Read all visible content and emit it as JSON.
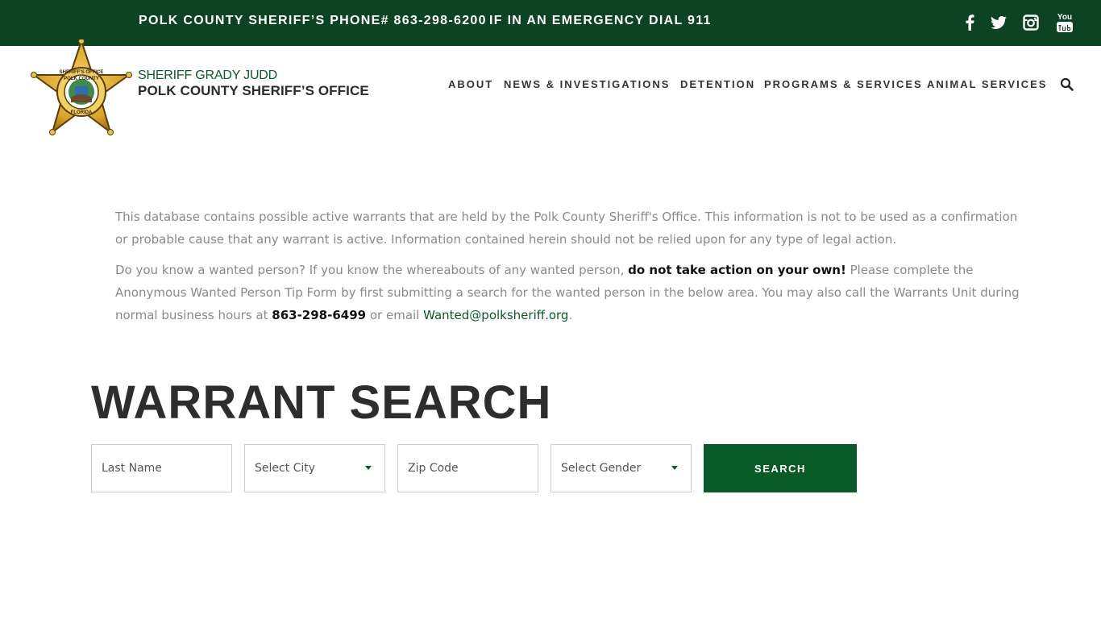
{
  "topbar": {
    "phone": "POLK COUNTY SHERIFF’S PHONE# 863-298-6200",
    "emergency": "IF IN AN EMERGENCY DIAL 911",
    "social_icons": [
      "facebook-icon",
      "twitter-icon",
      "instagram-icon",
      "youtube-icon"
    ],
    "youtube_label": "You"
  },
  "brand": {
    "line1": "SHERIFF GRADY JUDD",
    "line2": "POLK COUNTY SHERIFF’S OFFICE",
    "badge_text_top": "SHERIFF'S OFFICE",
    "badge_text_mid": "POLK COUNTY",
    "badge_text_bottom": "FLORIDA"
  },
  "nav": {
    "items": [
      "ABOUT",
      "NEWS & INVESTIGATIONS",
      "DETENTION",
      "PROGRAMS & SERVICES",
      "ANIMAL SERVICES"
    ]
  },
  "intro": {
    "p1": "This database contains possible active warrants that are held by the Polk County Sheriff's Office. This information is not to be used as a confirmation or probable cause that any warrant is active. Information contained herein should not be relied upon for any type of legal action.",
    "p2_a": "Do you know a wanted person? If you know the whereabouts of any wanted person, ",
    "p2_strong": "do not take action on your own!",
    "p2_b": " Please complete the Anonymous Wanted Person Tip Form by first submitting a search for the wanted person in the below area. You may also call the Warrants Unit during normal business hours at ",
    "p2_phone": "863-298-6499",
    "p2_c": " or email ",
    "p2_email": "Wanted@polksheriff.org",
    "p2_d": "."
  },
  "search": {
    "title": "WARRANT SEARCH",
    "last_name_placeholder": "Last Name",
    "city_selected": "Select City",
    "zip_placeholder": "Zip Code",
    "gender_selected": "Select Gender",
    "button_label": "SEARCH"
  },
  "colors": {
    "brand_dark_green": "#0c4423",
    "button_green": "#0a5a26",
    "accent_green": "#0c5a28",
    "badge_gold": "#d9a52b"
  }
}
